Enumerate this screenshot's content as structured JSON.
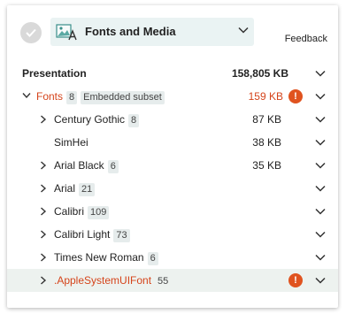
{
  "header": {
    "category_label": "Fonts and Media",
    "feedback_label": "Feedback",
    "category_icon": "image-font-icon"
  },
  "colors": {
    "warning": "#e0531f",
    "warning_text": "#d5441b",
    "select_bg": "#eaf3f3",
    "highlight_bg": "#edf2ef"
  },
  "summary": {
    "label": "Presentation",
    "size": "158,805 KB"
  },
  "fonts_group": {
    "label": "Fonts",
    "count": "8",
    "subset_tag": "Embedded subset",
    "size": "159 KB"
  },
  "fonts": [
    {
      "name": "Century Gothic",
      "count": "8",
      "size": "87 KB"
    },
    {
      "name": "SimHei",
      "count": "",
      "size": "38 KB"
    },
    {
      "name": "Arial Black",
      "count": "6",
      "size": "35 KB"
    },
    {
      "name": "Arial",
      "count": "21",
      "size": ""
    },
    {
      "name": "Calibri",
      "count": "109",
      "size": ""
    },
    {
      "name": "Calibri Light",
      "count": "73",
      "size": ""
    },
    {
      "name": "Times New Roman",
      "count": "6",
      "size": ""
    },
    {
      "name": ".AppleSystemUIFont",
      "count": "55",
      "size": ""
    }
  ]
}
